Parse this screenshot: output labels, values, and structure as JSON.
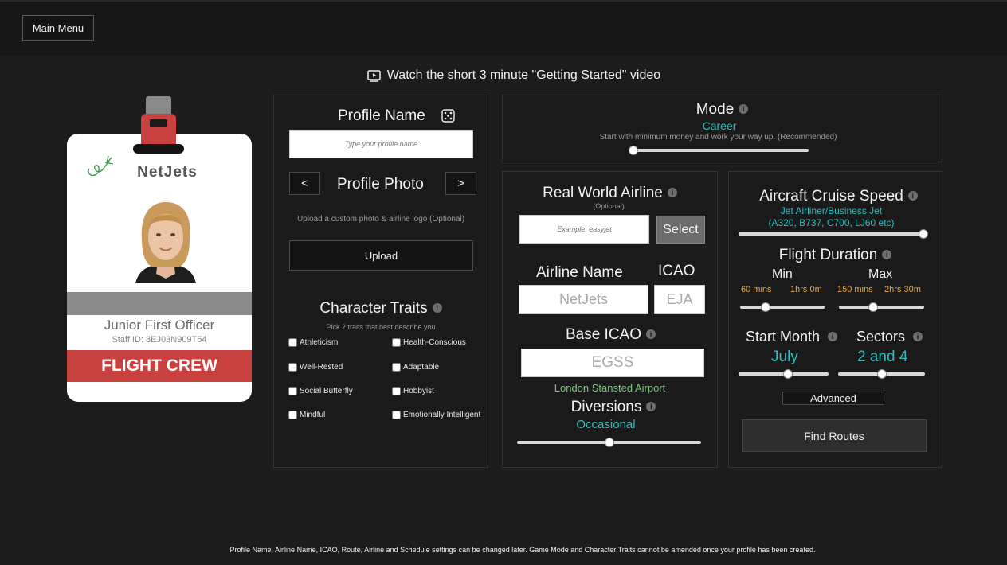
{
  "header": {
    "main_menu": "Main Menu"
  },
  "video_link": "Watch the short 3 minute \"Getting Started\" video",
  "id_card": {
    "airline": "NetJets",
    "rank": "Junior First Officer",
    "staff_id": "Staff ID: 8EJ03N909T54",
    "crew_label": "FLIGHT CREW"
  },
  "profile": {
    "name_title": "Profile Name",
    "name_placeholder": "Type your profile name",
    "photo_title": "Profile Photo",
    "prev": "<",
    "next": ">",
    "upload_hint": "Upload a custom photo & airline logo (Optional)",
    "upload_button": "Upload"
  },
  "traits": {
    "title": "Character Traits",
    "hint": "Pick 2 traits  that best describe you",
    "items": [
      "Athleticism",
      "Health-Conscious",
      "Well-Rested",
      "Adaptable",
      "Social Butterfly",
      "Hobbyist",
      "Mindful",
      "Emotionally Intelligent"
    ]
  },
  "mode": {
    "title": "Mode",
    "value": "Career",
    "description": "Start with minimum money and work your way up. (Recommended)",
    "slider_level": 0
  },
  "airline": {
    "title": "Real World Airline",
    "optional": "(Optional)",
    "input_placeholder": "Example: easyjet",
    "select_button": "Select",
    "name_title": "Airline Name",
    "icao_title": "ICAO",
    "name_value": "NetJets",
    "icao_value": "EJA",
    "base_title": "Base ICAO",
    "base_value": "EGSS",
    "base_airport": "London Stansted Airport",
    "diversions_title": "Diversions",
    "diversions_value": "Occasional",
    "diversions_level": 0.5
  },
  "routes": {
    "speed_title": "Aircraft Cruise Speed",
    "speed_value_line1": "Jet Airliner/Business Jet",
    "speed_value_line2": "(A320, B737, C700, LJ60 etc)",
    "speed_level": 1,
    "duration_title": "Flight Duration",
    "min_label": "Min",
    "max_label": "Max",
    "min_mins": "60 mins",
    "min_hrs": "1hrs 0m",
    "max_mins": "150 mins",
    "max_hrs": "2hrs 30m",
    "min_level": 0.3,
    "max_level": 0.4,
    "start_month_title": "Start Month",
    "start_month_value": "July",
    "start_month_level": 0.55,
    "sectors_title": "Sectors",
    "sectors_value": "2 and 4",
    "sectors_level": 0.5,
    "advanced_button": "Advanced",
    "find_routes_button": "Find Routes"
  },
  "footer_note": "Profile Name, Airline Name, ICAO, Route, Airline and Schedule settings can be changed later. Game Mode and Character Traits cannot be amended once your profile has been created."
}
